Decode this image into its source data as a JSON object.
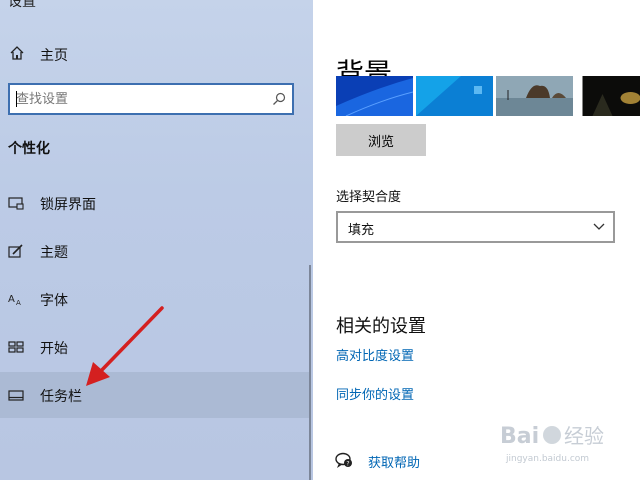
{
  "app": {
    "title": "设置"
  },
  "sidebar": {
    "home_label": "主页",
    "search_placeholder": "查找设置",
    "section_title": "个性化",
    "items": [
      {
        "label": "锁屏界面",
        "icon": "lock-screen-icon"
      },
      {
        "label": "主题",
        "icon": "theme-brush-icon"
      },
      {
        "label": "字体",
        "icon": "font-icon"
      },
      {
        "label": "开始",
        "icon": "start-tiles-icon"
      },
      {
        "label": "任务栏",
        "icon": "taskbar-icon",
        "active": true
      }
    ],
    "active_color": "#abbad4"
  },
  "main": {
    "title": "背景",
    "browse_label": "浏览",
    "fit_label": "选择契合度",
    "fit_value": "填充",
    "related_title": "相关的设置",
    "links": [
      "高对比度设置",
      "同步你的设置"
    ],
    "help_label": "获取帮助",
    "link_color": "#0066b4"
  },
  "watermark": {
    "brand": "Bai",
    "brand_cn": "经验",
    "url": "jingyan.baidu.com"
  },
  "annotation": {
    "color": "#d42020"
  }
}
